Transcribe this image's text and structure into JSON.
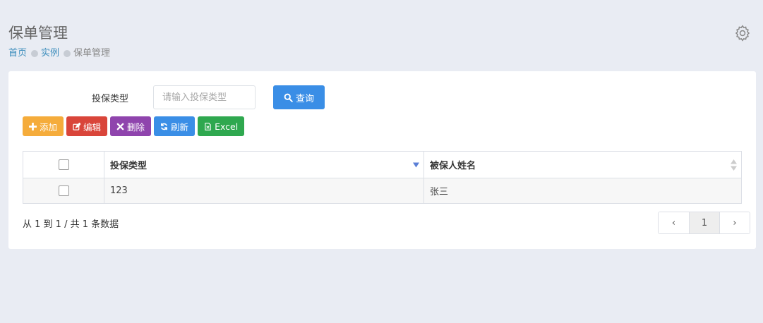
{
  "header": {
    "title": "保单管理",
    "breadcrumb": [
      "首页",
      "实例",
      "保单管理"
    ]
  },
  "search": {
    "label": "投保类型",
    "placeholder": "请输入投保类型",
    "value": "",
    "button_label": "查询"
  },
  "toolbar": {
    "add_label": "添加",
    "edit_label": "编辑",
    "delete_label": "删除",
    "refresh_label": "刷新",
    "excel_label": "Excel"
  },
  "table": {
    "columns": [
      "投保类型",
      "被保人姓名"
    ],
    "rows": [
      [
        "123",
        "张三"
      ]
    ]
  },
  "footer": {
    "summary": "从 1 到 1 / 共 1 条数据",
    "pagination": {
      "prev": "‹",
      "current_page": "1",
      "next": "›"
    }
  },
  "colors": {
    "background": "#e9ecf3",
    "primary": "#3a8ee6",
    "add": "#f5ac3b",
    "edit": "#d9453a",
    "delete": "#8f44ad",
    "excel": "#2fa84f",
    "link": "#3c8dbc"
  }
}
